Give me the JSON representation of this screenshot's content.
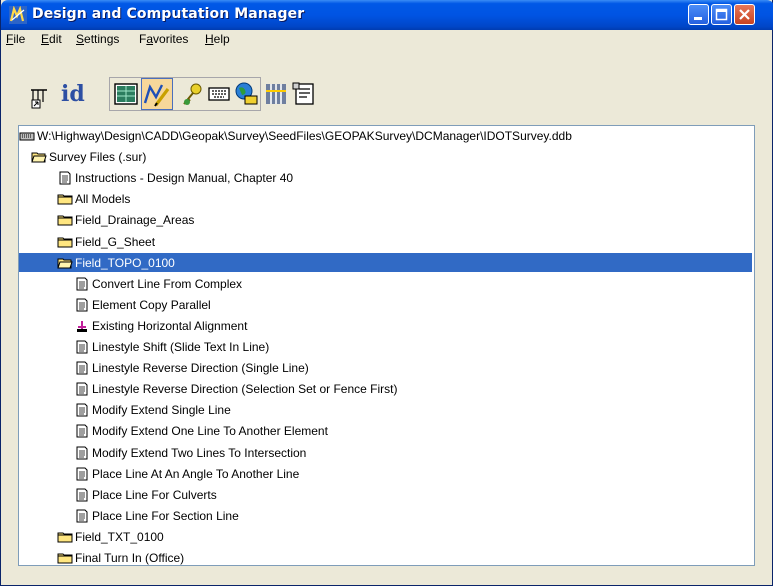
{
  "window": {
    "title": "Design and Computation Manager",
    "title_color": "#0054e3"
  },
  "menu": {
    "items": [
      "File",
      "Edit",
      "Settings",
      "Favorites",
      "Help"
    ]
  },
  "toolbar": {
    "buttons": [
      {
        "name": "pointer-tool-icon",
        "active": false
      },
      {
        "name": "id-tool-icon",
        "label": "id",
        "active": false
      },
      {
        "name": "table-view-icon",
        "active": false
      },
      {
        "name": "draw-mode-icon",
        "active": true
      },
      {
        "name": "key-icon",
        "active": false
      },
      {
        "name": "keyboard-icon",
        "active": false
      },
      {
        "name": "globe-icon",
        "active": false
      },
      {
        "name": "settings-grid-icon",
        "active": false
      },
      {
        "name": "properties-icon",
        "active": false
      }
    ]
  },
  "tree": {
    "rows": [
      {
        "label": "W:\\Highway\\Design\\CADD\\Geopak\\Survey\\SeedFiles\\GEOPAKSurvey\\DCManager\\IDOTSurvey.ddb",
        "icon": "database-icon"
      },
      {
        "label": "Survey Files (.sur)",
        "icon": "folder-open-icon"
      },
      {
        "label": "Instructions  - Design Manual, Chapter 40",
        "icon": "document-icon"
      },
      {
        "label": "All Models",
        "icon": "folder-icon"
      },
      {
        "label": "Field_Drainage_Areas",
        "icon": "folder-icon"
      },
      {
        "label": "Field_G_Sheet",
        "icon": "folder-icon"
      },
      {
        "label": "Field_TOPO_0100",
        "icon": "folder-open-icon",
        "selected": true
      },
      {
        "label": "Convert Line From Complex",
        "icon": "document-icon"
      },
      {
        "label": "Element Copy Parallel",
        "icon": "document-icon"
      },
      {
        "label": "Existing Horizontal Alignment",
        "icon": "alignment-icon"
      },
      {
        "label": "Linestyle Shift (Slide Text In Line)",
        "icon": "document-icon"
      },
      {
        "label": "Linestyle Reverse Direction (Single Line)",
        "icon": "document-icon"
      },
      {
        "label": "Linestyle Reverse Direction (Selection Set or Fence First)",
        "icon": "document-icon"
      },
      {
        "label": "Modify Extend Single Line",
        "icon": "document-icon"
      },
      {
        "label": "Modify Extend One Line To Another Element",
        "icon": "document-icon"
      },
      {
        "label": "Modify Extend Two Lines To Intersection",
        "icon": "document-icon"
      },
      {
        "label": "Place Line At An Angle To Another Line",
        "icon": "document-icon"
      },
      {
        "label": "Place Line For Culverts",
        "icon": "document-icon"
      },
      {
        "label": "Place Line For Section Line",
        "icon": "document-icon"
      },
      {
        "label": "Field_TXT_0100",
        "icon": "folder-icon"
      },
      {
        "label": "Final Turn In (Office)",
        "icon": "folder-icon"
      }
    ],
    "selection_color": "#316ac5"
  }
}
